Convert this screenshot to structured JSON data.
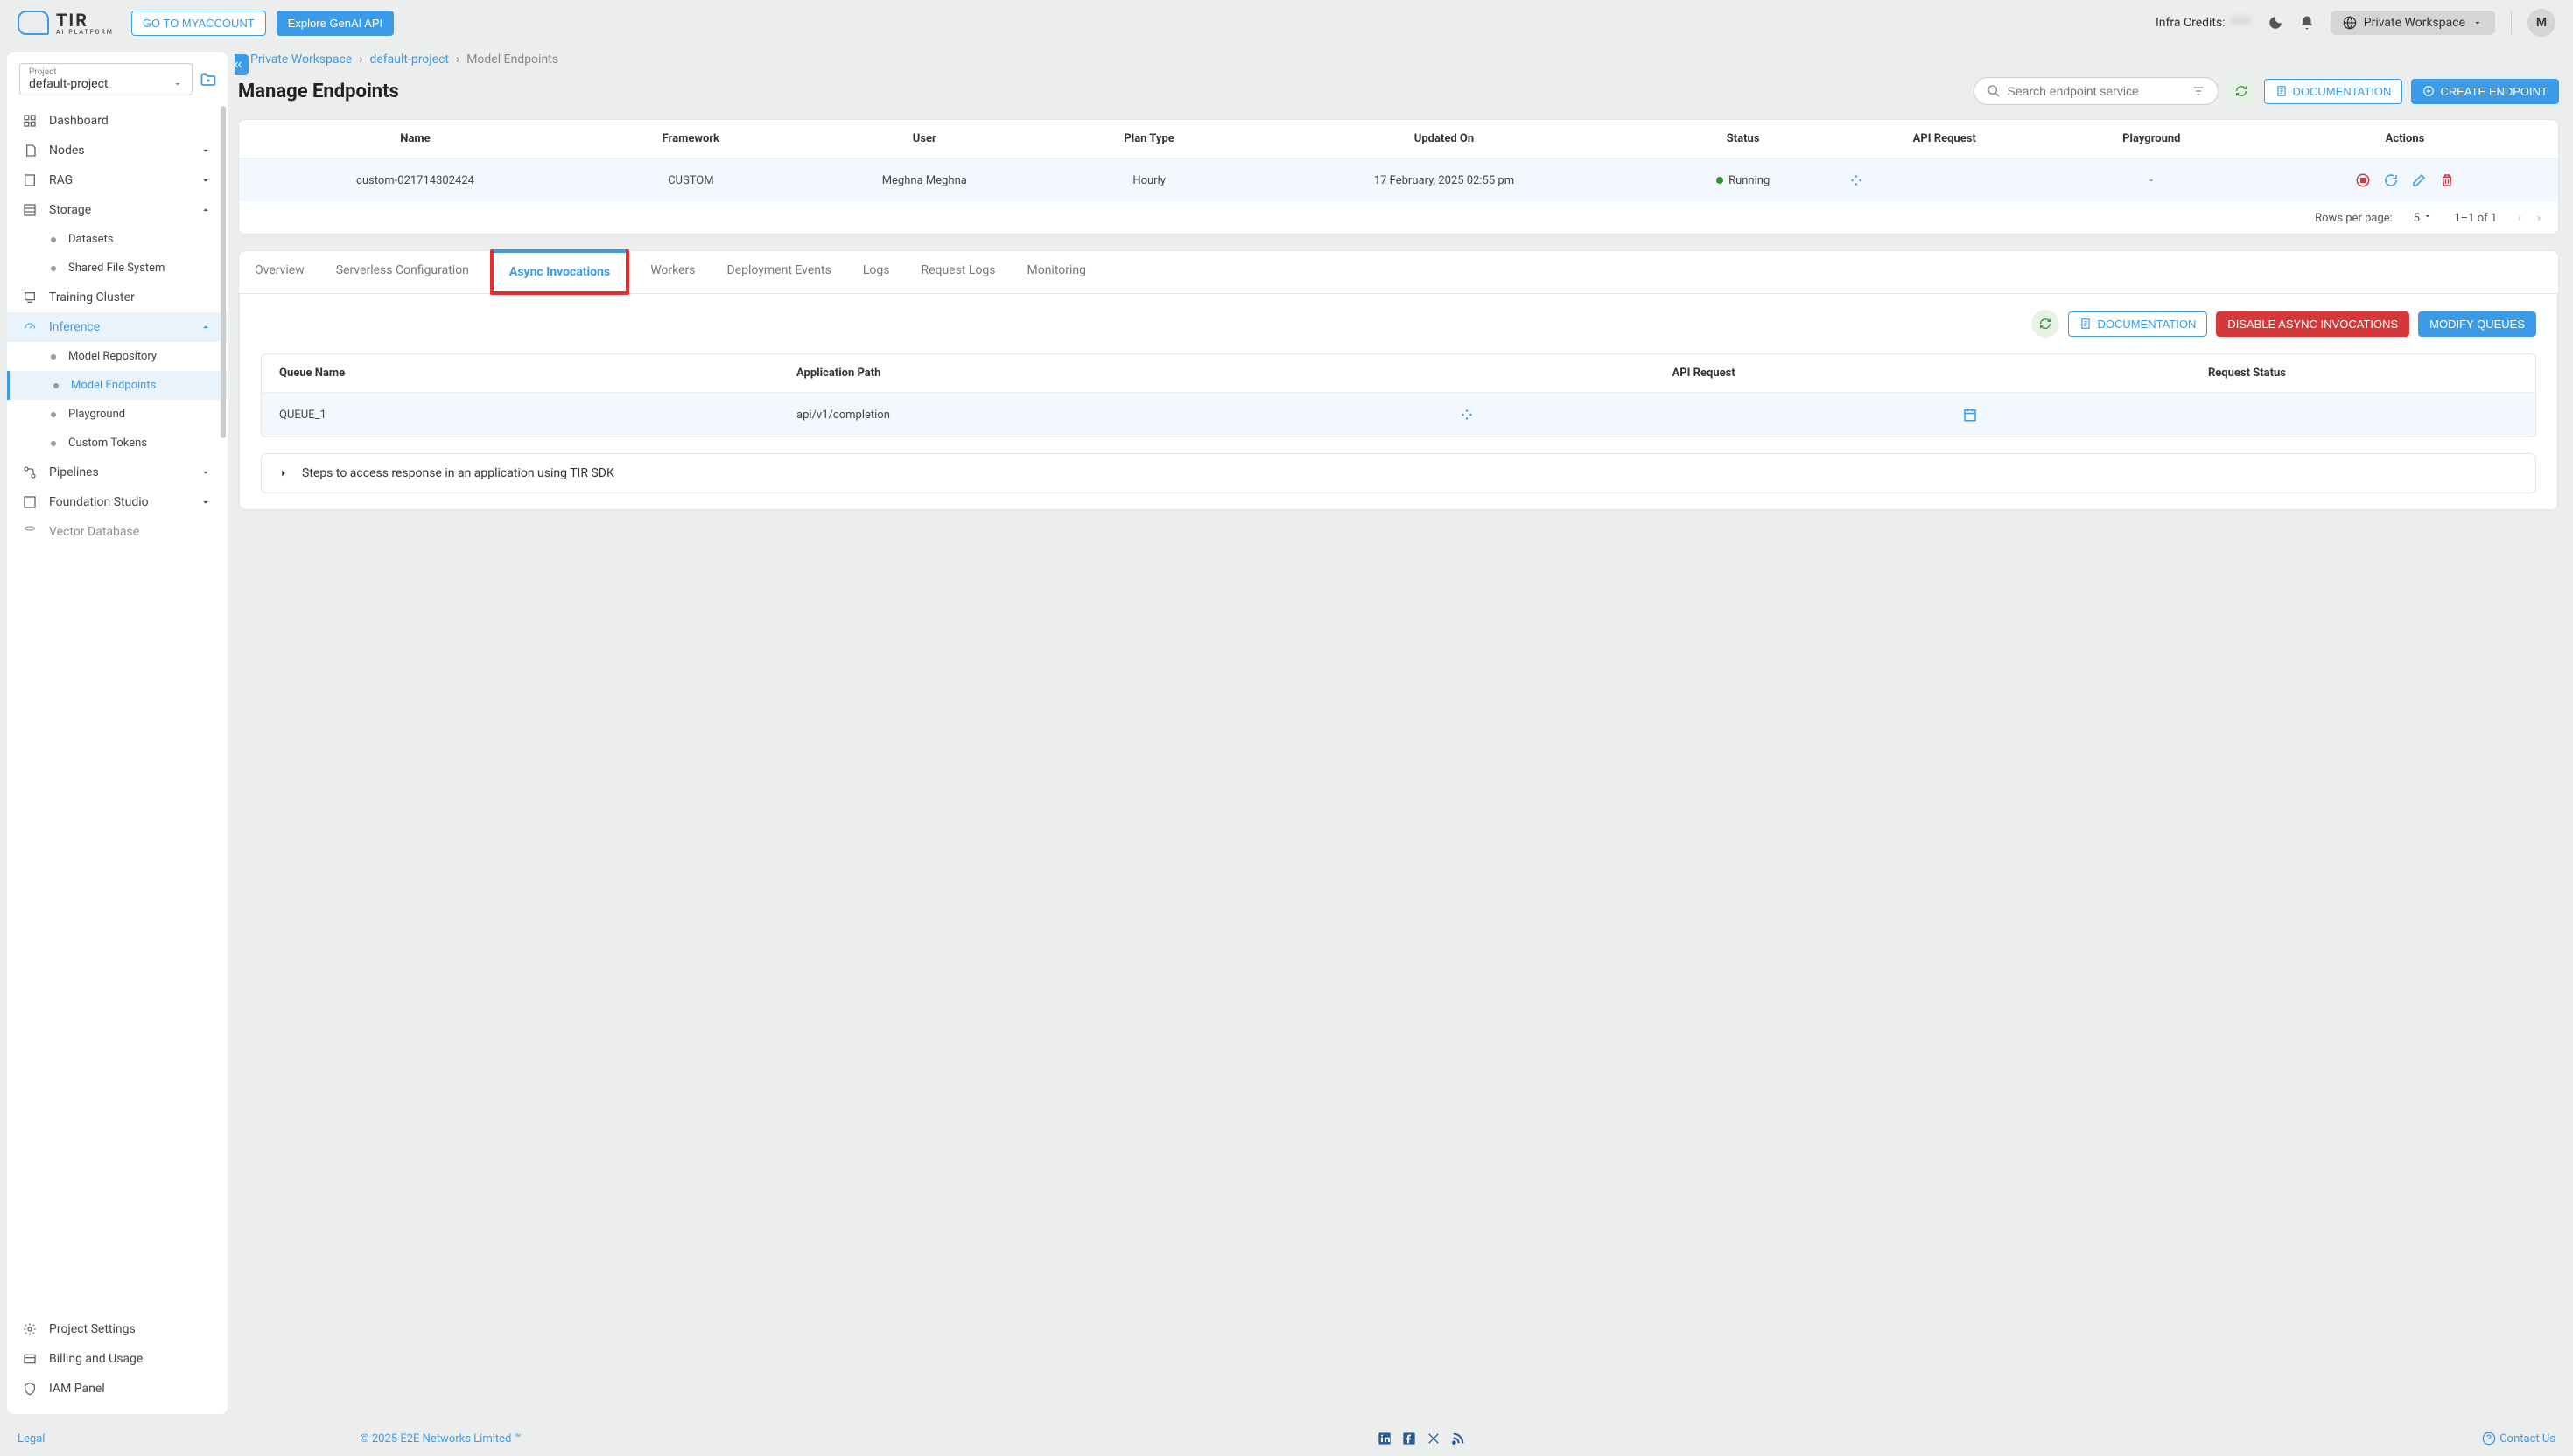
{
  "brand": {
    "name": "TIR",
    "sub": "AI PLATFORM"
  },
  "topbar": {
    "myaccount": "GO TO MYACCOUNT",
    "explore": "Explore GenAI API",
    "credits_label": "Infra Credits:",
    "credits_value": "****",
    "workspace_label": "Private Workspace",
    "avatar_letter": "M"
  },
  "sidebar": {
    "project_label": "Project",
    "project_value": "default-project",
    "items": {
      "dashboard": "Dashboard",
      "nodes": "Nodes",
      "rag": "RAG",
      "storage": "Storage",
      "datasets": "Datasets",
      "sfs": "Shared File System",
      "training": "Training Cluster",
      "inference": "Inference",
      "model_repo": "Model Repository",
      "model_endpoints": "Model Endpoints",
      "playground": "Playground",
      "custom_tokens": "Custom Tokens",
      "pipelines": "Pipelines",
      "foundation": "Foundation Studio",
      "vectordb": "Vector Database",
      "proj_settings": "Project Settings",
      "billing": "Billing and Usage",
      "iam": "IAM Panel"
    }
  },
  "breadcrumb": {
    "l1": "Private Workspace",
    "l2": "default-project",
    "l3": "Model Endpoints"
  },
  "page": {
    "title": "Manage Endpoints",
    "search_placeholder": "Search endpoint service",
    "doc_btn": "DOCUMENTATION",
    "create_btn": "CREATE ENDPOINT"
  },
  "endpoint_table": {
    "headers": {
      "name": "Name",
      "framework": "Framework",
      "user": "User",
      "plan": "Plan Type",
      "updated": "Updated On",
      "status": "Status",
      "api": "API Request",
      "playground": "Playground",
      "actions": "Actions"
    },
    "row": {
      "name": "custom-021714302424",
      "framework": "CUSTOM",
      "user": "Meghna Meghna",
      "plan": "Hourly",
      "updated": "17 February, 2025 02:55 pm",
      "status": "Running",
      "playground": "-"
    },
    "pagination": {
      "rpp_label": "Rows per page:",
      "rpp_value": "5",
      "range": "1–1 of 1"
    }
  },
  "tabs": {
    "overview": "Overview",
    "serverless": "Serverless Configuration",
    "async": "Async Invocations",
    "workers": "Workers",
    "deployment": "Deployment Events",
    "logs": "Logs",
    "reqlogs": "Request Logs",
    "monitoring": "Monitoring"
  },
  "async_panel": {
    "doc_btn": "DOCUMENTATION",
    "disable_btn": "DISABLE ASYNC INVOCATIONS",
    "modify_btn": "MODIFY QUEUES",
    "headers": {
      "queue": "Queue Name",
      "path": "Application Path",
      "api": "API Request",
      "status": "Request Status"
    },
    "row": {
      "queue": "QUEUE_1",
      "path": "api/v1/completion"
    },
    "expand": "Steps to access response in an application using TIR SDK"
  },
  "footer": {
    "legal": "Legal",
    "copyright": "© 2025 E2E Networks Limited ™",
    "contact": "Contact Us"
  }
}
